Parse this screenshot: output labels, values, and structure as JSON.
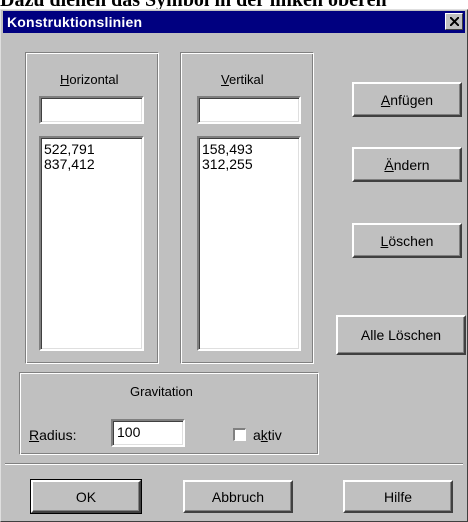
{
  "page_caption": "Dazu dienen das Symbol in der linken oberen",
  "window": {
    "title": "Konstruktionslinien"
  },
  "horizontal": {
    "label_accel": "H",
    "label_rest": "orizontal",
    "input_value": "",
    "items": [
      "522,791",
      "837,412"
    ]
  },
  "vertical": {
    "label_accel": "V",
    "label_rest": "ertikal",
    "input_value": "",
    "items": [
      "158,493",
      "312,255"
    ]
  },
  "buttons": {
    "add_accel": "A",
    "add_rest": "nfügen",
    "change_accel": "Ä",
    "change_rest": "ndern",
    "delete_accel": "L",
    "delete_rest": "öschen",
    "delete_all": "Alle Löschen",
    "ok": "OK",
    "cancel": "Abbruch",
    "help": "Hilfe"
  },
  "gravitation": {
    "title": "Gravitation",
    "radius_accel": "R",
    "radius_rest": "adius:",
    "radius_value": "100",
    "active_pre": "a",
    "active_accel": "k",
    "active_post": "tiv",
    "active_checked": false
  }
}
